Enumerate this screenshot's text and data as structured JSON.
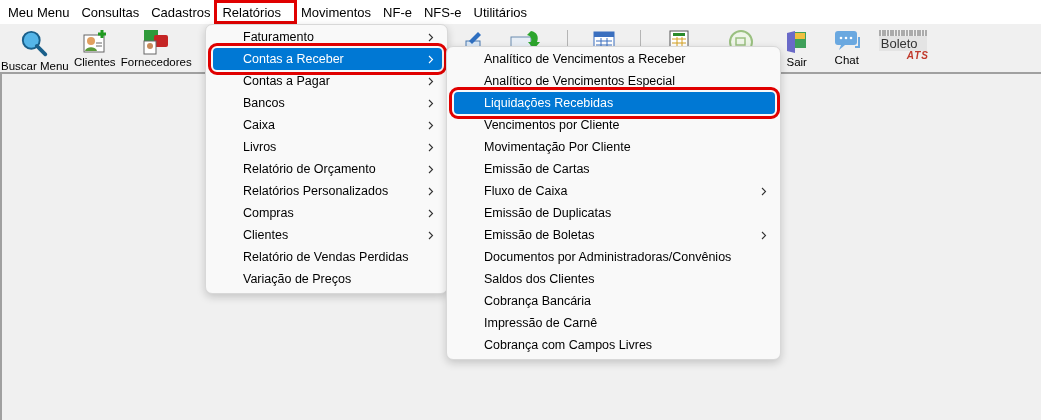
{
  "menu_bar": [
    {
      "label": "Meu Menu",
      "highlighted": false
    },
    {
      "label": "Consultas",
      "highlighted": false
    },
    {
      "label": "Cadastros",
      "highlighted": false
    },
    {
      "label": "Relatórios",
      "highlighted": true
    },
    {
      "label": "Movimentos",
      "highlighted": false
    },
    {
      "label": "NF-e",
      "highlighted": false
    },
    {
      "label": "NFS-e",
      "highlighted": false
    },
    {
      "label": "Utilitários",
      "highlighted": false
    }
  ],
  "toolbar": [
    {
      "kind": "button",
      "label": "Buscar Menu"
    },
    {
      "kind": "button",
      "label": "Clientes"
    },
    {
      "kind": "button",
      "label": "Fornecedores"
    },
    {
      "kind": "hidden"
    },
    {
      "kind": "button"
    },
    {
      "kind": "button"
    },
    {
      "kind": "separator"
    },
    {
      "kind": "button"
    },
    {
      "kind": "separator"
    },
    {
      "kind": "button"
    },
    {
      "kind": "button"
    },
    {
      "kind": "button",
      "label": "Sair"
    },
    {
      "kind": "button",
      "label": "Chat"
    },
    {
      "kind": "logo",
      "text": "Boleto",
      "sub": "ATS"
    }
  ],
  "menus": [
    {
      "items": [
        {
          "label": "Faturamento",
          "submenu": true,
          "selected": false,
          "highlighted": false
        },
        {
          "label": "Contas a Receber",
          "submenu": true,
          "selected": true,
          "highlighted": true
        },
        {
          "label": "Contas a Pagar",
          "submenu": true,
          "selected": false,
          "highlighted": false
        },
        {
          "label": "Bancos",
          "submenu": true,
          "selected": false,
          "highlighted": false
        },
        {
          "label": "Caixa",
          "submenu": true,
          "selected": false,
          "highlighted": false
        },
        {
          "label": "Livros",
          "submenu": true,
          "selected": false,
          "highlighted": false
        },
        {
          "label": "Relatório de Orçamento",
          "submenu": true,
          "selected": false,
          "highlighted": false
        },
        {
          "label": "Relatórios Personalizados",
          "submenu": true,
          "selected": false,
          "highlighted": false
        },
        {
          "label": "Compras",
          "submenu": true,
          "selected": false,
          "highlighted": false
        },
        {
          "label": "Clientes",
          "submenu": true,
          "selected": false,
          "highlighted": false
        },
        {
          "label": "Relatório de Vendas Perdidas",
          "submenu": false,
          "selected": false,
          "highlighted": false
        },
        {
          "label": "Variação de Preços",
          "submenu": false,
          "selected": false,
          "highlighted": false
        }
      ]
    },
    {
      "items": [
        {
          "label": "Analítico de Vencimentos a Receber",
          "submenu": false,
          "selected": false,
          "highlighted": false
        },
        {
          "label": "Analítico de Vencimentos Especial",
          "submenu": false,
          "selected": false,
          "highlighted": false
        },
        {
          "label": "Liquidações Recebidas",
          "submenu": false,
          "selected": true,
          "highlighted": true
        },
        {
          "label": "Vencimentos por Cliente",
          "submenu": false,
          "selected": false,
          "highlighted": false
        },
        {
          "label": "Movimentação Por Cliente",
          "submenu": false,
          "selected": false,
          "highlighted": false
        },
        {
          "label": "Emissão de Cartas",
          "submenu": false,
          "selected": false,
          "highlighted": false
        },
        {
          "label": "Fluxo de Caixa",
          "submenu": true,
          "selected": false,
          "highlighted": false
        },
        {
          "label": "Emissão de Duplicatas",
          "submenu": false,
          "selected": false,
          "highlighted": false
        },
        {
          "label": "Emissão de Boletas",
          "submenu": true,
          "selected": false,
          "highlighted": false
        },
        {
          "label": "Documentos por Administradoras/Convênios",
          "submenu": false,
          "selected": false,
          "highlighted": false
        },
        {
          "label": "Saldos dos Clientes",
          "submenu": false,
          "selected": false,
          "highlighted": false
        },
        {
          "label": "Cobrança Bancária",
          "submenu": false,
          "selected": false,
          "highlighted": false
        },
        {
          "label": "Impressão de Carnê",
          "submenu": false,
          "selected": false,
          "highlighted": false
        },
        {
          "label": "Cobrança com Campos Livres",
          "submenu": false,
          "selected": false,
          "highlighted": false
        }
      ]
    }
  ]
}
